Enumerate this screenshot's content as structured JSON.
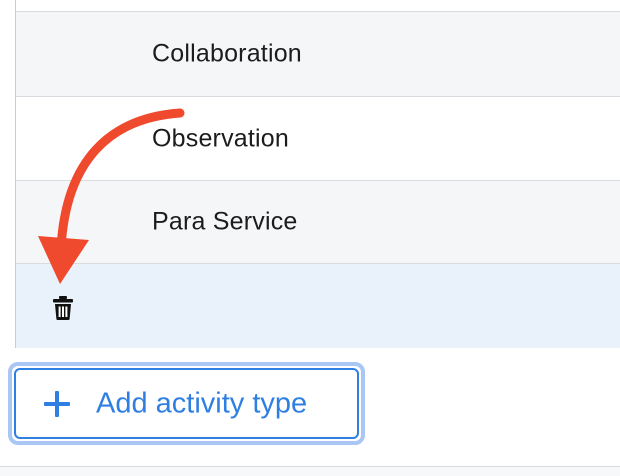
{
  "activity_types": {
    "rows": [
      {
        "label": ""
      },
      {
        "label": "Collaboration"
      },
      {
        "label": "Observation"
      },
      {
        "label": "Para Service"
      },
      {
        "label": ""
      }
    ]
  },
  "new_row": {
    "delete_icon": "trash-icon"
  },
  "annotation": {
    "arrow_color": "#ef4a2d",
    "icon": "curved-arrow"
  },
  "add_button": {
    "label": "Add activity type",
    "icon": "plus-icon",
    "color": "#2f7fe3",
    "focus_ring": "#a9c6f4"
  },
  "colors": {
    "row_alt": "#f5f6f8",
    "row_selected": "#e9f1fb",
    "border": "#c9cdd2"
  }
}
